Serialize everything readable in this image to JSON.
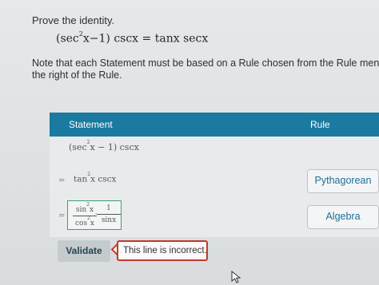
{
  "prompt": "Prove the identity.",
  "identity": {
    "lhs_open": "(sec",
    "lhs_exp": "2",
    "lhs_rest": "x−1) cscx",
    "equals": "=",
    "rhs": "tanx secx"
  },
  "note": "Note that each Statement must be based on a Rule chosen from the Rule menu. To se",
  "note_line2": "the right of the Rule.",
  "table": {
    "header_statement": "Statement",
    "header_rule": "Rule"
  },
  "rows": [
    {
      "expr_open": "(sec",
      "exp": "2",
      "expr_rest": "x − 1) cscx"
    },
    {
      "eq": "=",
      "expr_open": "tan",
      "exp": "2",
      "expr_rest": "x cscx",
      "rule": "Pythagorean"
    },
    {
      "eq": "=",
      "frac1_num": "sin",
      "frac1_num_exp": "2",
      "frac1_num_var": "x",
      "frac1_den": "cos",
      "frac1_den_exp": "2",
      "frac1_den_var": "x",
      "times": "·",
      "frac2_num": "1",
      "frac2_den": "sinx",
      "rule": "Algebra"
    }
  ],
  "validate_label": "Validate",
  "error_message": "This line is incorrect.",
  "colors": {
    "header_bg": "#1a7aa0",
    "error_border": "#c0392b",
    "active_border": "#3f9f75",
    "rule_text": "#1f6f95"
  },
  "icons": {
    "cursor": "mouse-pointer-icon"
  }
}
